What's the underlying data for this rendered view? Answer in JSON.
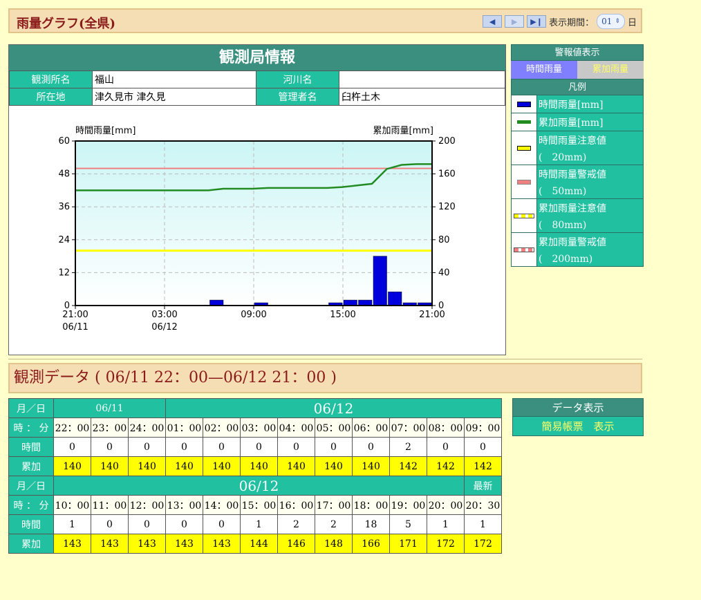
{
  "header": {
    "title": "雨量グラフ(全県)",
    "period_label": "表示期間：",
    "period_value": "01",
    "period_unit": "日"
  },
  "station": {
    "title": "観測局情報",
    "name_label": "観測所名",
    "name_value": "福山",
    "river_label": "河川名",
    "river_value": "",
    "location_label": "所在地",
    "location_value": "津久見市 津久見",
    "manager_label": "管理者名",
    "manager_value": "臼杵土木"
  },
  "chart_data": {
    "type": "bar",
    "ylabel": "時間雨量[mm]",
    "y2label": "累加雨量[mm]",
    "ylim": [
      0,
      60
    ],
    "y2lim": [
      0,
      200
    ],
    "yticks": [
      "0",
      "12",
      "24",
      "36",
      "48",
      "60"
    ],
    "y2ticks": [
      "0",
      "40",
      "80",
      "120",
      "160",
      "200"
    ],
    "xticks": [
      {
        "time": "21:00",
        "date": "06/11"
      },
      {
        "time": "03:00",
        "date": "06/12"
      },
      {
        "time": "09:00",
        "date": ""
      },
      {
        "time": "15:00",
        "date": ""
      },
      {
        "time": "21:00",
        "date": ""
      }
    ],
    "hours": [
      "21:00",
      "22:00",
      "23:00",
      "24:00",
      "01:00",
      "02:00",
      "03:00",
      "04:00",
      "05:00",
      "06:00",
      "07:00",
      "08:00",
      "09:00",
      "10:00",
      "11:00",
      "12:00",
      "13:00",
      "14:00",
      "15:00",
      "16:00",
      "17:00",
      "18:00",
      "19:00",
      "20:00",
      "20:30"
    ],
    "series": [
      {
        "name": "時間雨量[mm]",
        "values": [
          0,
          0,
          0,
          0,
          0,
          0,
          0,
          0,
          0,
          2,
          0,
          0,
          1,
          0,
          0,
          0,
          0,
          1,
          2,
          2,
          18,
          5,
          1,
          1
        ]
      },
      {
        "name": "累加雨量[mm]",
        "values": [
          140,
          140,
          140,
          140,
          140,
          140,
          140,
          140,
          140,
          142,
          142,
          142,
          143,
          143,
          143,
          143,
          143,
          144,
          146,
          148,
          166,
          171,
          172,
          172
        ]
      }
    ],
    "caution_hourly": 20,
    "warning_hourly": 50,
    "colors": {
      "bar": "#0000dd",
      "cumulative": "#228b22",
      "caution": "#ffff00",
      "warning": "#f08080"
    }
  },
  "side": {
    "alarm_title": "警報値表示",
    "toggle_hourly": "時間雨量",
    "toggle_cumulative": "累加雨量",
    "legend_title": "凡例",
    "legend": [
      {
        "line1": "時間雨量[mm]",
        "line2": ""
      },
      {
        "line1": "累加雨量[mm]",
        "line2": ""
      },
      {
        "line1": "時間雨量注意値",
        "line2": "(　20mm)"
      },
      {
        "line1": "時間雨量警戒値",
        "line2": "(　50mm)"
      },
      {
        "line1": "累加雨量注意値",
        "line2": "(　80mm)"
      },
      {
        "line1": "累加雨量警戒値",
        "line2": "(　200mm)"
      }
    ]
  },
  "obs": {
    "title": "観測データ ( 06/11 22：00—06/12 21：00 )",
    "row_date": "月／日",
    "row_time": "時 ： 分",
    "row_hourly": "時間",
    "row_cum": "累加",
    "date1": "06/11",
    "date2": "06/12",
    "latest": "最新",
    "times1": [
      "22：00",
      "23：00",
      "24：00",
      "01：00",
      "02：00",
      "03：00",
      "04：00",
      "05：00",
      "06：00",
      "07：00",
      "08：00",
      "09：00"
    ],
    "hourly1": [
      "0",
      "0",
      "0",
      "0",
      "0",
      "0",
      "0",
      "0",
      "0",
      "2",
      "0",
      "0"
    ],
    "cum1": [
      "140",
      "140",
      "140",
      "140",
      "140",
      "140",
      "140",
      "140",
      "140",
      "142",
      "142",
      "142"
    ],
    "times2": [
      "10：00",
      "11：00",
      "12：00",
      "13：00",
      "14：00",
      "15：00",
      "16：00",
      "17：00",
      "18：00",
      "19：00",
      "20：00",
      "20：30"
    ],
    "hourly2": [
      "1",
      "0",
      "0",
      "0",
      "0",
      "1",
      "2",
      "2",
      "18",
      "5",
      "1",
      "1"
    ],
    "cum2": [
      "143",
      "143",
      "143",
      "143",
      "143",
      "144",
      "146",
      "148",
      "166",
      "171",
      "172",
      "172"
    ]
  },
  "data_display": {
    "title": "データ表示",
    "link": "簡易帳票　表示"
  }
}
